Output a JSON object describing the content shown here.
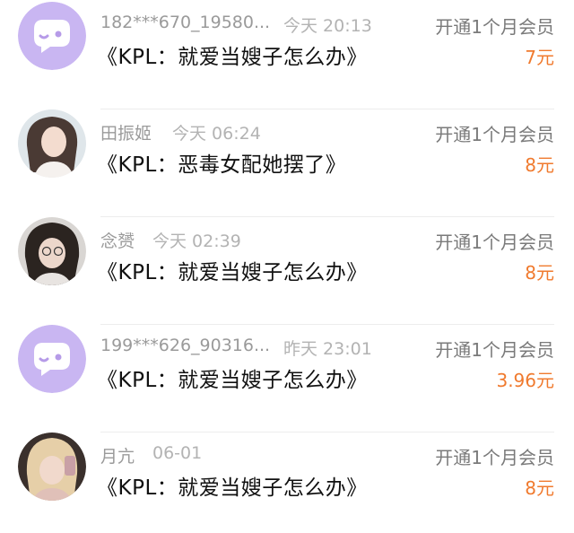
{
  "records": [
    {
      "avatar_icon": "chat-bubble-icon",
      "name": "182***670_19580...",
      "time": "今天 20:13",
      "action": "开通1个月会员",
      "title": "《KPL：就爱当嫂子怎么办》",
      "price": "7元"
    },
    {
      "avatar_icon": "user-photo",
      "name": "田振姬",
      "time": "今天 06:24",
      "action": "开通1个月会员",
      "title": "《KPL：恶毒女配她摆了》",
      "price": "8元"
    },
    {
      "avatar_icon": "user-photo",
      "name": "念赟",
      "time": "今天 02:39",
      "action": "开通1个月会员",
      "title": "《KPL：就爱当嫂子怎么办》",
      "price": "8元"
    },
    {
      "avatar_icon": "chat-bubble-icon",
      "name": "199***626_90316...",
      "time": "昨天 23:01",
      "action": "开通1个月会员",
      "title": "《KPL：就爱当嫂子怎么办》",
      "price": "3.96元"
    },
    {
      "avatar_icon": "user-photo",
      "name": "月亢",
      "time": "06-01",
      "action": "开通1个月会员",
      "title": "《KPL：就爱当嫂子怎么办》",
      "price": "8元"
    }
  ],
  "colors": {
    "accent_price": "#f07a2e",
    "default_avatar_bg": "#c9b6f2"
  }
}
